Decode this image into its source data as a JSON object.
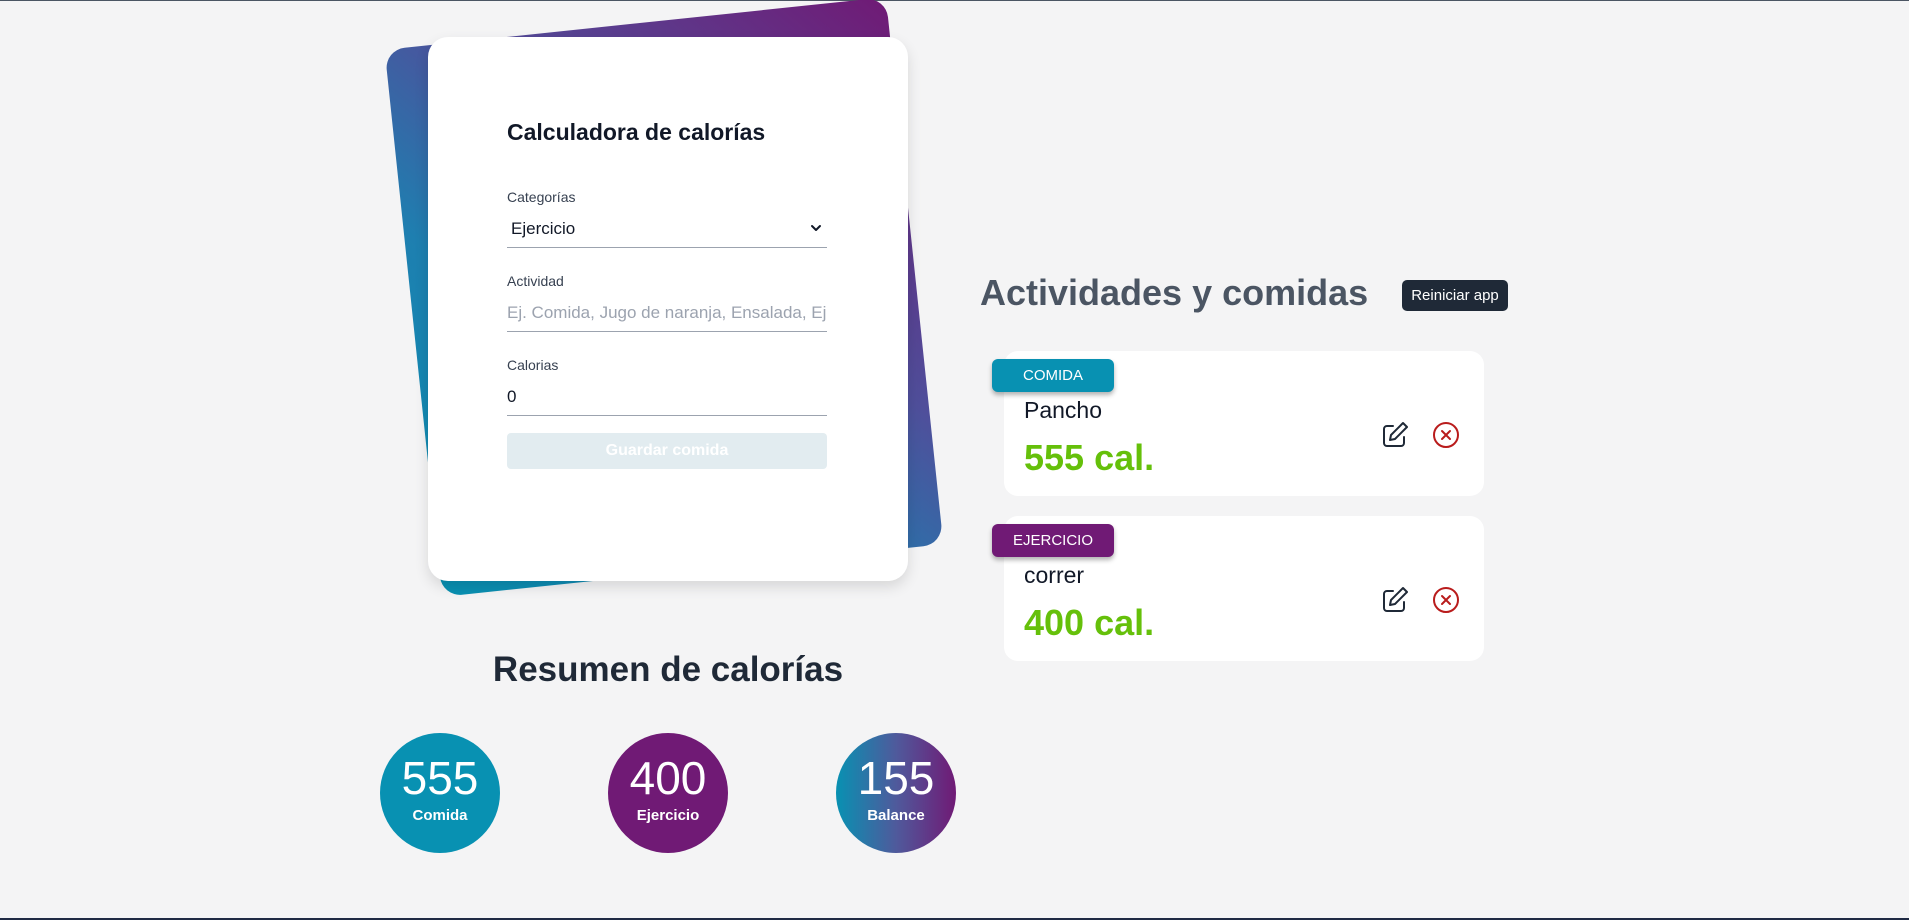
{
  "form": {
    "title": "Calculadora de calorías",
    "category_label": "Categorías",
    "category_value": "Ejercicio",
    "activity_label": "Actividad",
    "activity_placeholder": "Ej. Comida, Jugo de naranja, Ensalada, Ejercicio, Pesas, Bicicleta",
    "calories_label": "Calorias",
    "calories_value": "0",
    "save_label": "Guardar comida"
  },
  "summary": {
    "title": "Resumen de calorías",
    "stats": [
      {
        "value": "555",
        "label": "Comida",
        "color": "#0891b2"
      },
      {
        "value": "400",
        "label": "Ejercicio",
        "color": "#701a75"
      },
      {
        "value": "155",
        "label": "Balance",
        "color": "gradient"
      }
    ]
  },
  "list": {
    "title": "Actividades y comidas",
    "reset_label": "Reiniciar app",
    "items": [
      {
        "category": "COMIDA",
        "name": "Pancho",
        "calories": "555 cal.",
        "badge_color": "#0891b2"
      },
      {
        "category": "EJERCICIO",
        "name": "correr",
        "calories": "400 cal.",
        "badge_color": "#701a75"
      }
    ]
  },
  "colors": {
    "accent_blue": "#0891b2",
    "accent_purple": "#701a75",
    "calorie_green": "#65c00a",
    "delete_red": "#b91c1c",
    "background": "#f4f4f5"
  },
  "icons": {
    "edit": "pencil-square-icon",
    "delete": "x-circle-icon",
    "select": "chevron-down-icon"
  }
}
